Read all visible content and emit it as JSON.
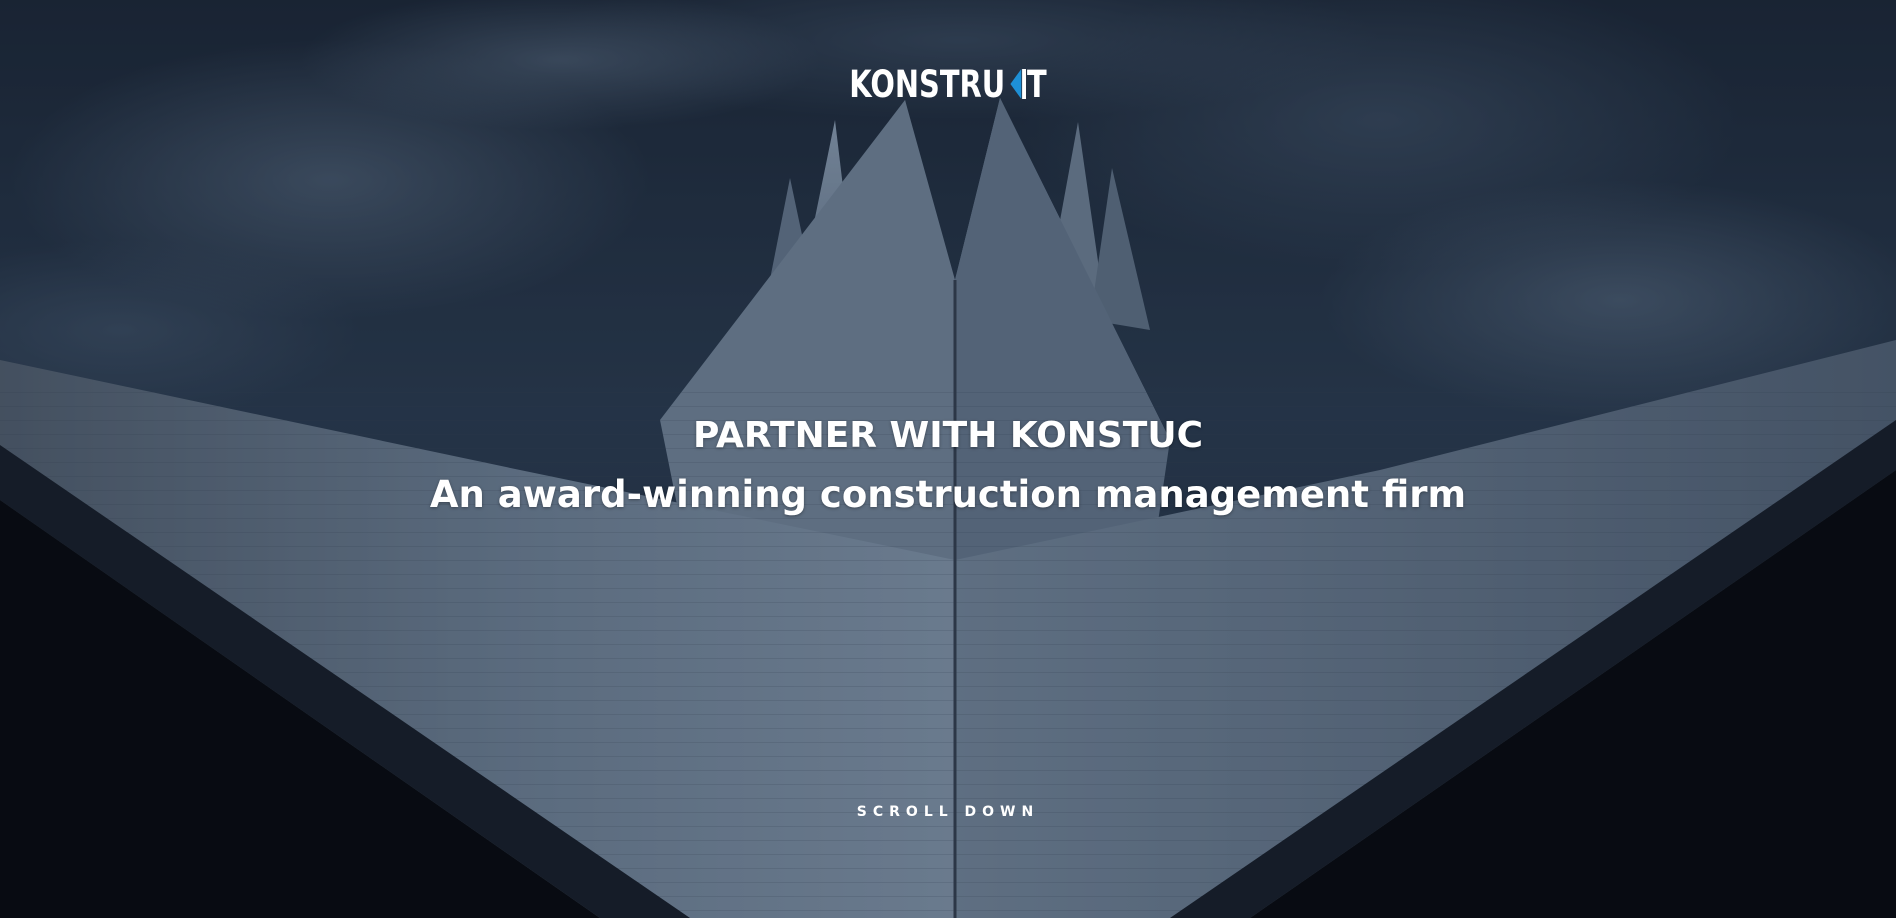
{
  "logo": {
    "text_before": "KONSTRU",
    "text_after": "T",
    "mark_color": "#1e90d6"
  },
  "hero": {
    "background": "cloudy-sky-tent-roof-photo",
    "title": "PARTNER WITH KONSTUC",
    "subtitle": "An award-winning construction management firm",
    "scroll_label": "SCROLL DOWN"
  }
}
